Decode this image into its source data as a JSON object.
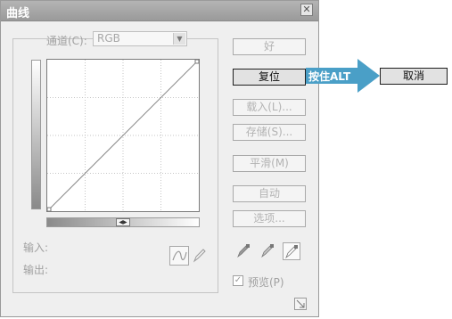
{
  "dialog": {
    "title": "曲线",
    "close_glyph": "✕",
    "channel_label": "通道(C):",
    "channel_value": "RGB",
    "input_label": "输入:",
    "output_label": "输出:",
    "preview_label": "预览(P)",
    "preview_checked": true,
    "buttons": {
      "ok": "好",
      "reset": "复位",
      "load": "载入(L)...",
      "save": "存储(S)...",
      "smooth": "平滑(M)",
      "auto": "自动",
      "options": "选项..."
    },
    "tools": {
      "curve_tool_icon": "curve-point-icon",
      "pencil_tool_icon": "pencil-icon",
      "black_eyedropper_icon": "eyedropper-black-icon",
      "gray_eyedropper_icon": "eyedropper-gray-icon",
      "white_eyedropper_icon": "eyedropper-white-icon"
    }
  },
  "callout": {
    "text": "按住ALT",
    "color": "#4a9fc7",
    "cancel_label": "取消"
  }
}
